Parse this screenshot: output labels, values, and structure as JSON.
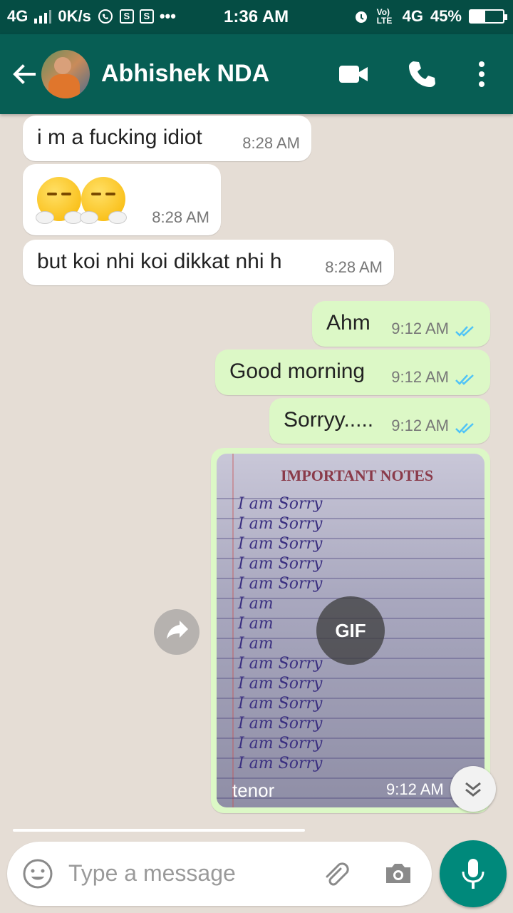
{
  "status_bar": {
    "network": "4G",
    "speed": "0K/s",
    "time": "1:36 AM",
    "volte": "Vo) LTE",
    "network2": "4G",
    "battery_percent": "45%",
    "battery_level": 0.45,
    "more": "•••"
  },
  "header": {
    "contact_name": "Abhishek NDA",
    "icons": [
      "back-arrow-icon",
      "video-call-icon",
      "phone-icon",
      "more-vert-icon"
    ]
  },
  "messages": [
    {
      "direction": "in",
      "text": "i m a fucking idiot",
      "time": "8:28 AM"
    },
    {
      "direction": "in",
      "emoji": "face-with-steam-from-nose x2",
      "time": "8:28 AM"
    },
    {
      "direction": "in",
      "text": "but koi nhi koi dikkat nhi h",
      "time": "8:28 AM"
    },
    {
      "direction": "out",
      "text": "Ahm",
      "time": "9:12 AM",
      "status": "read"
    },
    {
      "direction": "out",
      "text": "Good morning",
      "time": "9:12 AM",
      "status": "read"
    },
    {
      "direction": "out",
      "text": "Sorryy.....",
      "time": "9:12 AM",
      "status": "read"
    },
    {
      "direction": "out",
      "type": "gif",
      "badge": "GIF",
      "source": "tenor",
      "time": "9:12 AM",
      "image_text": {
        "title": "IMPORTANT NOTES",
        "lines": [
          "I am Sorry",
          "I am Sorry",
          "I am Sorry",
          "I am Sorry",
          "I am Sorry",
          "I am",
          "I am",
          "I am",
          "I am Sorry",
          "I am Sorry",
          "I am Sorry",
          "I am Sorry",
          "I am Sorry",
          "I am Sorry"
        ]
      }
    }
  ],
  "input": {
    "placeholder": "Type a message"
  },
  "colors": {
    "header": "#075e54",
    "status_bar": "#054d44",
    "outgoing_bubble": "#dcf8c6",
    "incoming_bubble": "#ffffff",
    "mic_button": "#00897b",
    "read_ticks": "#4fc3f7"
  }
}
